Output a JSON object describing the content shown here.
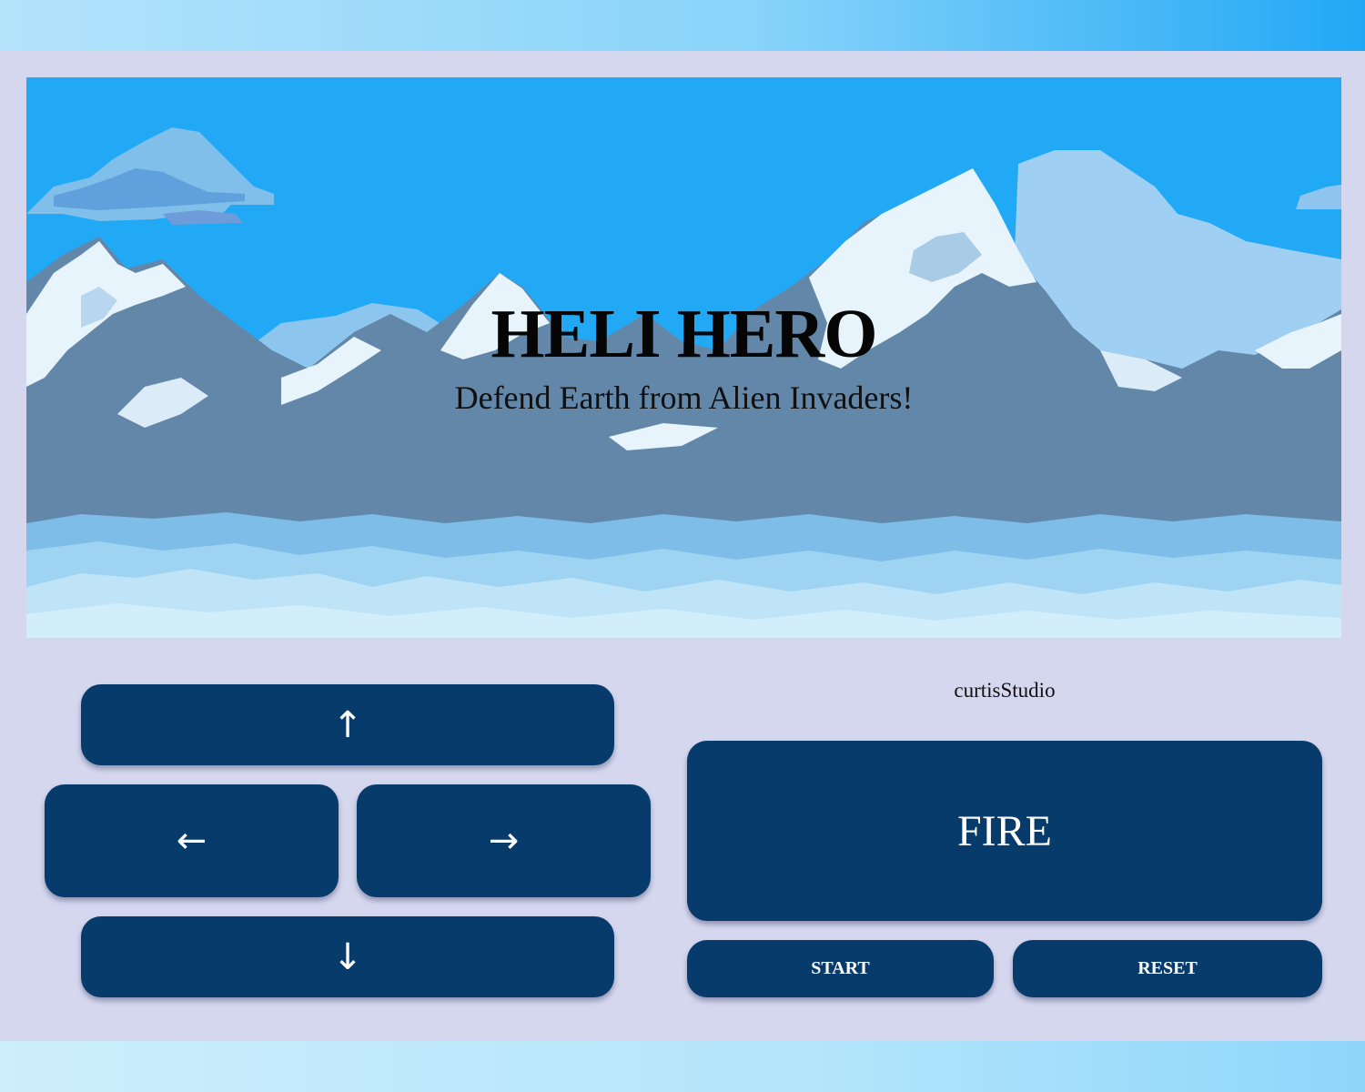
{
  "game": {
    "title": "HELI HERO",
    "subtitle": "Defend Earth from Alien Invaders!"
  },
  "controls": {
    "up_icon": "arrow-up-icon",
    "up_label": "↑",
    "left_icon": "arrow-left-icon",
    "left_label": "←",
    "right_icon": "arrow-right-icon",
    "right_label": "→",
    "down_icon": "arrow-down-icon",
    "down_label": "↓",
    "fire_label": "FIRE",
    "start_label": "START",
    "reset_label": "RESET"
  },
  "studio": {
    "name": "curtisStudio"
  },
  "colors": {
    "button": "#073b6b",
    "panel": "#d5d7ef",
    "sky": "#21a9f6",
    "mountain": "#6387a8",
    "snow": "#e8f4fb",
    "cloud": "#9fd3f2"
  }
}
